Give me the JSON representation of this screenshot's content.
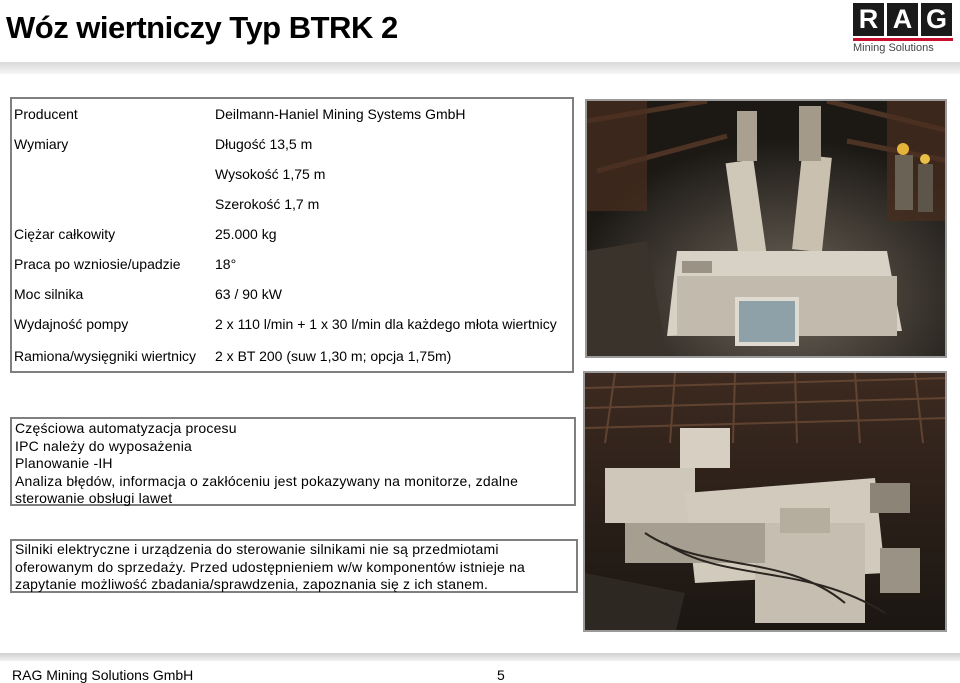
{
  "slide": {
    "title": "Wóz wiertniczy Typ BTRK 2"
  },
  "logo": {
    "letters": [
      "R",
      "A",
      "G"
    ],
    "subtitle": "Mining Solutions"
  },
  "specs": [
    {
      "label": "Producent",
      "value": "Deilmann-Haniel Mining Systems GmbH"
    },
    {
      "label": "Wymiary",
      "value": "Długość 13,5 m"
    },
    {
      "label": "",
      "value": "Wysokość 1,75 m"
    },
    {
      "label": "",
      "value": "Szerokość 1,7 m"
    },
    {
      "label": "Ciężar całkowity",
      "value": "25.000 kg"
    },
    {
      "label": "Praca  po wzniosie/upadzie",
      "value": "18°"
    },
    {
      "label": "Moc silnika",
      "value": "63 / 90 kW"
    },
    {
      "label": "Wydajność pompy",
      "value": "2 x 110 l/min + 1 x 30 l/min dla każdego młota wiertnicy"
    },
    {
      "label": "Ramiona/wysięgniki wiertnicy",
      "value": "2 x BT 200 (suw 1,30 m; opcja 1,75m)"
    }
  ],
  "features_box": {
    "lines": [
      "Częściowa automatyzacja procesu",
      "IPC należy do wyposażenia",
      "Planowanie -IH",
      "Analiza błędów, informacja o zakłóceniu jest pokazywany na monitorze, zdalne",
      "sterowanie obsługi lawet"
    ]
  },
  "note_box": {
    "lines": [
      "Silniki elektryczne i urządzenia do sterowanie silnikami nie są przedmiotami",
      "oferowanym do sprzedaży. Przed udostępnieniem w/w komponentów istnieje na",
      "zapytanie możliwość zbadania/sprawdzenia, zapoznania się z ich stanem."
    ]
  },
  "footer": {
    "company": "RAG Mining Solutions GmbH",
    "page": "5"
  },
  "colors": {
    "logo_red": "#c8102e",
    "box_border": "#7f7f7f",
    "photo_dark": "#2a2520"
  }
}
